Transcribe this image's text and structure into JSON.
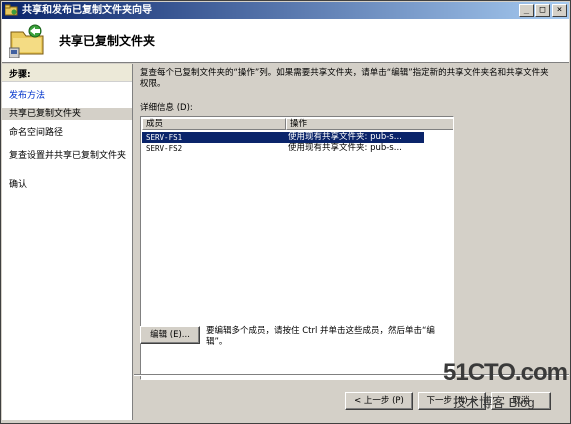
{
  "window": {
    "title": "共享和发布已复制文件夹向导",
    "minimize_glyph": "_",
    "maximize_glyph": "□",
    "close_glyph": "×"
  },
  "header": {
    "title": "共享已复制文件夹"
  },
  "sidebar": {
    "header": "步骤:",
    "items": [
      {
        "label": "发布方法"
      },
      {
        "label": "共享已复制文件夹"
      },
      {
        "label": "命名空间路径"
      },
      {
        "label": "复查设置并共享已复制文件夹"
      },
      {
        "label": "确认"
      }
    ]
  },
  "content": {
    "description": "复查每个已复制文件夹的“操作”列。如果需要共享文件夹，请单击“编辑”指定新的共享文件夹名和共享文件夹权限。",
    "details_label": "详细信息 (D):",
    "table": {
      "columns": [
        "成员",
        "操作"
      ],
      "rows": [
        {
          "member": "SERV-FS1",
          "action": "使用现有共享文件夹: pub-s..."
        },
        {
          "member": "SERV-FS2",
          "action": "使用现有共享文件夹: pub-s..."
        }
      ]
    },
    "edit_button": "编辑 (E)...",
    "edit_hint": "要编辑多个成员，请按住 Ctrl 并单击这些成员，然后单击“编辑”。"
  },
  "footer": {
    "back_button": "< 上一步 (P)",
    "next_button": "下一步 (N) >",
    "cancel_button": "取消"
  },
  "watermark": {
    "line1": "51CTO.com",
    "line2": "技术博客  Blog"
  },
  "colors": {
    "title_bar": "#0a246a",
    "selection": "#0a246a",
    "link": "#0033cc",
    "face": "#d4d0c8"
  }
}
